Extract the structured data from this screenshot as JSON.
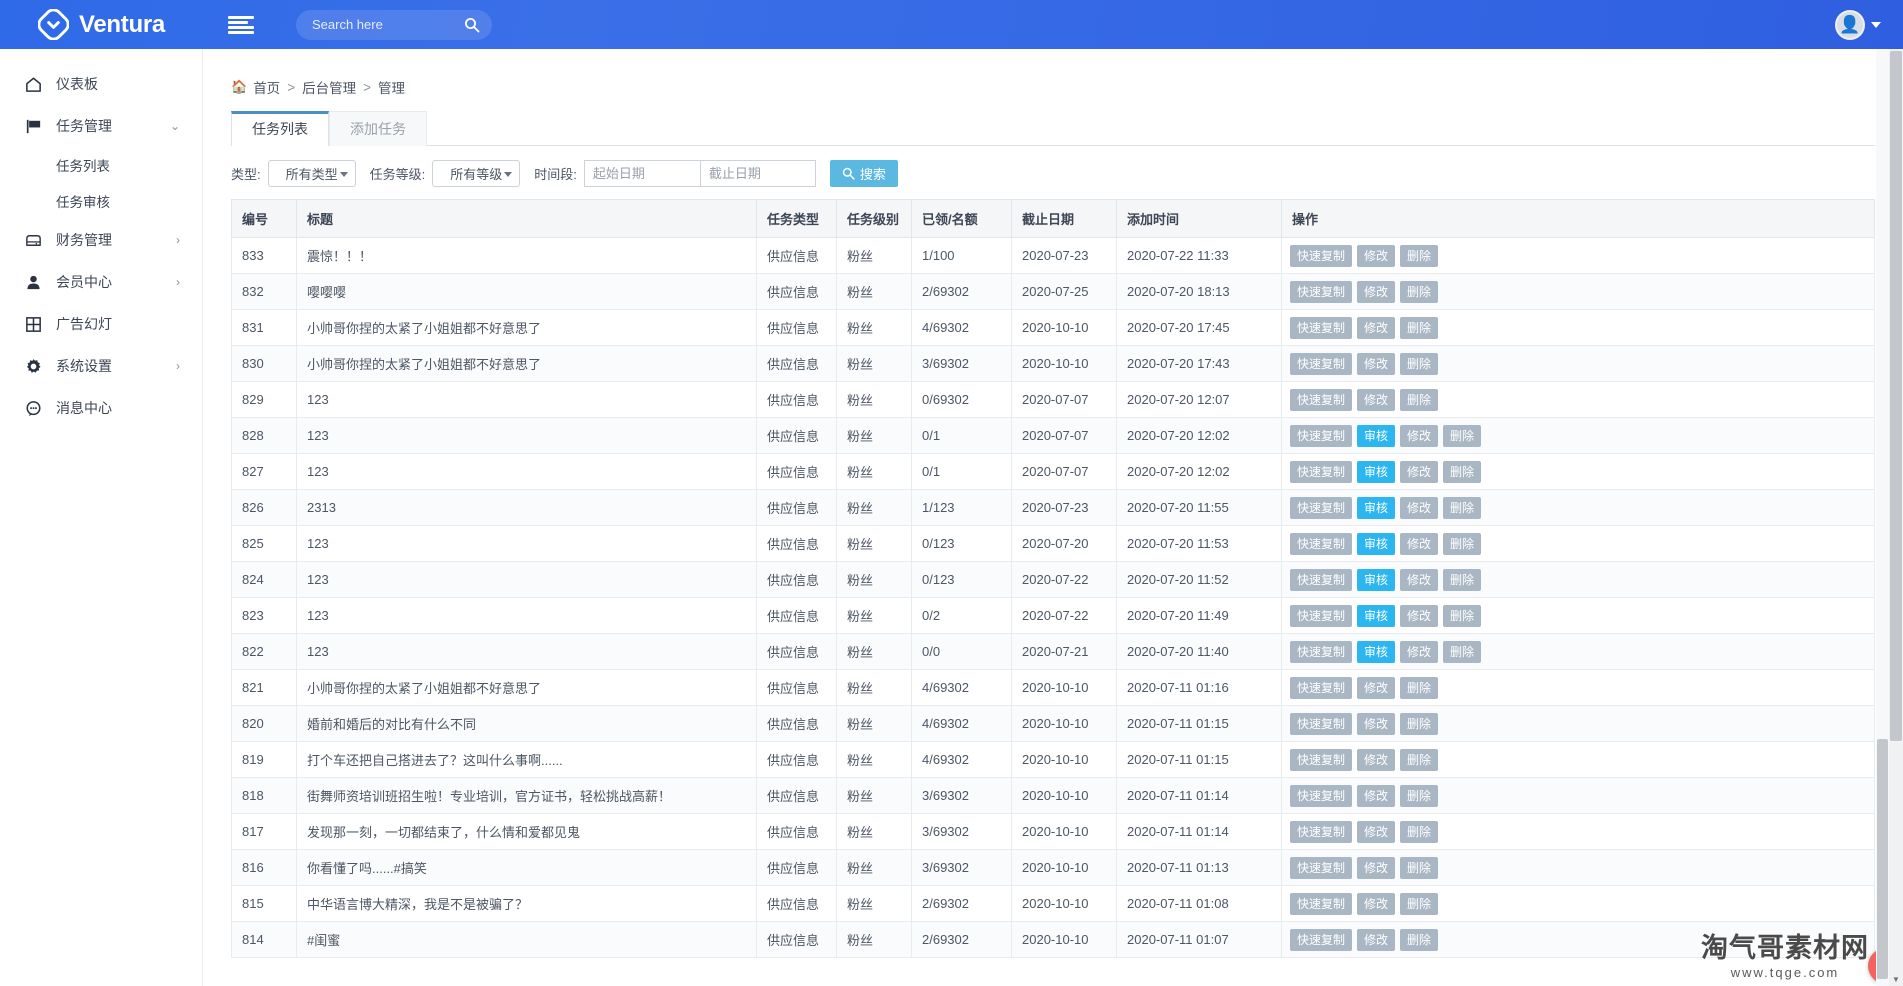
{
  "topbar": {
    "brand_name": "Ventura",
    "logo_icon": "diamond-check-logo",
    "menu_icon": "hamburger-menu-icon",
    "search_placeholder": "Search here",
    "search_value": "",
    "search_icon": "search-icon",
    "avatar_icon": "user-avatar",
    "caret_icon": "chevron-down-icon"
  },
  "sidebar": {
    "items": [
      {
        "label": "仪表板",
        "icon": "home-icon",
        "arrow": "",
        "sub": []
      },
      {
        "label": "任务管理",
        "icon": "flag-icon",
        "arrow": "⌄",
        "sub": [
          "任务列表",
          "任务审核"
        ]
      },
      {
        "label": "财务管理",
        "icon": "bank-icon",
        "arrow": "›",
        "sub": []
      },
      {
        "label": "会员中心",
        "icon": "user-icon",
        "arrow": "›",
        "sub": []
      },
      {
        "label": "广告幻灯",
        "icon": "grid-icon",
        "arrow": "",
        "sub": []
      },
      {
        "label": "系统设置",
        "icon": "gear-icon",
        "arrow": "›",
        "sub": []
      },
      {
        "label": "消息中心",
        "icon": "chat-icon",
        "arrow": "",
        "sub": []
      }
    ]
  },
  "breadcrumb": {
    "home_icon": "home-icon",
    "items": [
      "首页",
      "后台管理",
      "管理"
    ],
    "separator": ">"
  },
  "tabs": [
    {
      "label": "任务列表",
      "active": true
    },
    {
      "label": "添加任务",
      "active": false
    }
  ],
  "filters": {
    "type_label": "类型:",
    "type_value": "所有类型",
    "level_label": "任务等级:",
    "level_value": "所有等级",
    "period_label": "时间段:",
    "date_start_placeholder": "起始日期",
    "date_start_value": "",
    "date_end_placeholder": "截止日期",
    "date_end_value": "",
    "search_button": "搜索",
    "search_button_icon": "search-icon",
    "accent_color": "#5bb8e0"
  },
  "table": {
    "headers": [
      "编号",
      "标题",
      "任务类型",
      "任务级别",
      "已领/名额",
      "截止日期",
      "添加时间",
      "操作"
    ],
    "buttons": {
      "copy": "快速复制",
      "review": "审核",
      "edit": "修改",
      "delete": "删除"
    },
    "rows": [
      {
        "id": "833",
        "title": "震惊！！！",
        "type": "供应信息",
        "level": "粉丝",
        "quota": "1/100",
        "deadline": "2020-07-23",
        "added": "2020-07-22 11:33",
        "review": false
      },
      {
        "id": "832",
        "title": "嘤嘤嘤",
        "type": "供应信息",
        "level": "粉丝",
        "quota": "2/69302",
        "deadline": "2020-07-25",
        "added": "2020-07-20 18:13",
        "review": false
      },
      {
        "id": "831",
        "title": "小帅哥你捏的太紧了小姐姐都不好意思了",
        "type": "供应信息",
        "level": "粉丝",
        "quota": "4/69302",
        "deadline": "2020-10-10",
        "added": "2020-07-20 17:45",
        "review": false
      },
      {
        "id": "830",
        "title": "小帅哥你捏的太紧了小姐姐都不好意思了",
        "type": "供应信息",
        "level": "粉丝",
        "quota": "3/69302",
        "deadline": "2020-10-10",
        "added": "2020-07-20 17:43",
        "review": false
      },
      {
        "id": "829",
        "title": "123",
        "type": "供应信息",
        "level": "粉丝",
        "quota": "0/69302",
        "deadline": "2020-07-07",
        "added": "2020-07-20 12:07",
        "review": false
      },
      {
        "id": "828",
        "title": "123",
        "type": "供应信息",
        "level": "粉丝",
        "quota": "0/1",
        "deadline": "2020-07-07",
        "added": "2020-07-20 12:02",
        "review": true
      },
      {
        "id": "827",
        "title": "123",
        "type": "供应信息",
        "level": "粉丝",
        "quota": "0/1",
        "deadline": "2020-07-07",
        "added": "2020-07-20 12:02",
        "review": true
      },
      {
        "id": "826",
        "title": "2313",
        "type": "供应信息",
        "level": "粉丝",
        "quota": "1/123",
        "deadline": "2020-07-23",
        "added": "2020-07-20 11:55",
        "review": true
      },
      {
        "id": "825",
        "title": "123",
        "type": "供应信息",
        "level": "粉丝",
        "quota": "0/123",
        "deadline": "2020-07-20",
        "added": "2020-07-20 11:53",
        "review": true
      },
      {
        "id": "824",
        "title": "123",
        "type": "供应信息",
        "level": "粉丝",
        "quota": "0/123",
        "deadline": "2020-07-22",
        "added": "2020-07-20 11:52",
        "review": true
      },
      {
        "id": "823",
        "title": "123",
        "type": "供应信息",
        "level": "粉丝",
        "quota": "0/2",
        "deadline": "2020-07-22",
        "added": "2020-07-20 11:49",
        "review": true
      },
      {
        "id": "822",
        "title": "123",
        "type": "供应信息",
        "level": "粉丝",
        "quota": "0/0",
        "deadline": "2020-07-21",
        "added": "2020-07-20 11:40",
        "review": true
      },
      {
        "id": "821",
        "title": "小帅哥你捏的太紧了小姐姐都不好意思了",
        "type": "供应信息",
        "level": "粉丝",
        "quota": "4/69302",
        "deadline": "2020-10-10",
        "added": "2020-07-11 01:16",
        "review": false
      },
      {
        "id": "820",
        "title": "婚前和婚后的对比有什么不同",
        "type": "供应信息",
        "level": "粉丝",
        "quota": "4/69302",
        "deadline": "2020-10-10",
        "added": "2020-07-11 01:15",
        "review": false
      },
      {
        "id": "819",
        "title": "打个车还把自己搭进去了？这叫什么事啊......",
        "type": "供应信息",
        "level": "粉丝",
        "quota": "4/69302",
        "deadline": "2020-10-10",
        "added": "2020-07-11 01:15",
        "review": false
      },
      {
        "id": "818",
        "title": "街舞师资培训班招生啦！专业培训，官方证书，轻松挑战高薪！",
        "type": "供应信息",
        "level": "粉丝",
        "quota": "3/69302",
        "deadline": "2020-10-10",
        "added": "2020-07-11 01:14",
        "review": false
      },
      {
        "id": "817",
        "title": "发现那一刻，一切都结束了，什么情和爱都见鬼",
        "type": "供应信息",
        "level": "粉丝",
        "quota": "3/69302",
        "deadline": "2020-10-10",
        "added": "2020-07-11 01:14",
        "review": false
      },
      {
        "id": "816",
        "title": "你看懂了吗......#搞笑",
        "type": "供应信息",
        "level": "粉丝",
        "quota": "3/69302",
        "deadline": "2020-10-10",
        "added": "2020-07-11 01:13",
        "review": false
      },
      {
        "id": "815",
        "title": "中华语言博大精深，我是不是被骗了？",
        "type": "供应信息",
        "level": "粉丝",
        "quota": "2/69302",
        "deadline": "2020-10-10",
        "added": "2020-07-11 01:08",
        "review": false
      },
      {
        "id": "814",
        "title": "#闺蜜",
        "type": "供应信息",
        "level": "粉丝",
        "quota": "2/69302",
        "deadline": "2020-10-10",
        "added": "2020-07-11 01:07",
        "review": false
      }
    ]
  },
  "watermark": {
    "main": "淘气哥素材网",
    "sub": "www.tqge.com",
    "badge_icon": "panda-badge-icon"
  }
}
